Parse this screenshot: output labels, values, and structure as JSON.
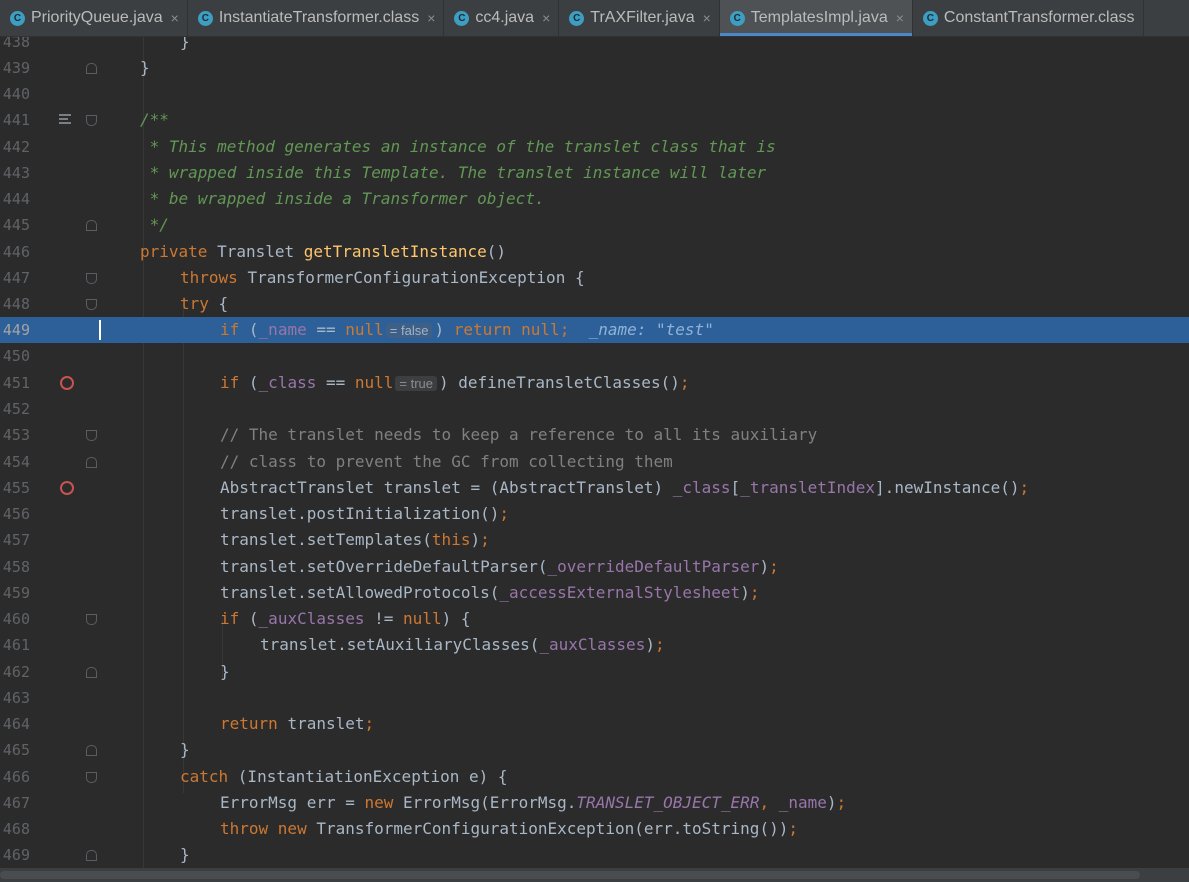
{
  "tabs": [
    {
      "label": "PriorityQueue.java",
      "active": false
    },
    {
      "label": "InstantiateTransformer.class",
      "active": false
    },
    {
      "label": "cc4.java",
      "active": false
    },
    {
      "label": "TrAXFilter.java",
      "active": false
    },
    {
      "label": "TemplatesImpl.java",
      "active": true
    },
    {
      "label": "ConstantTransformer.class",
      "active": false
    }
  ],
  "close_glyph": "×",
  "file_icon_letter": "C",
  "colors": {
    "background": "#2b2b2b",
    "current_line": "#2d6099",
    "keyword": "#cc7832",
    "method": "#ffc66d",
    "field": "#9876aa",
    "doc_comment": "#629755",
    "comment": "#808080",
    "breakpoint": "#c75450"
  },
  "editor": {
    "current_line": "449",
    "line_numbers": [
      "438",
      "439",
      "440",
      "441",
      "442",
      "443",
      "444",
      "445",
      "446",
      "447",
      "448",
      "449",
      "450",
      "451",
      "452",
      "453",
      "454",
      "455",
      "456",
      "457",
      "458",
      "459",
      "460",
      "461",
      "462",
      "463",
      "464",
      "465",
      "466",
      "467",
      "468",
      "469"
    ],
    "breakpoint_lines": [
      "451",
      "455"
    ],
    "hints": {
      "line449_hint": "= false",
      "line449_inline": "_name: \"test\"",
      "line451_hint": "= true"
    }
  }
}
